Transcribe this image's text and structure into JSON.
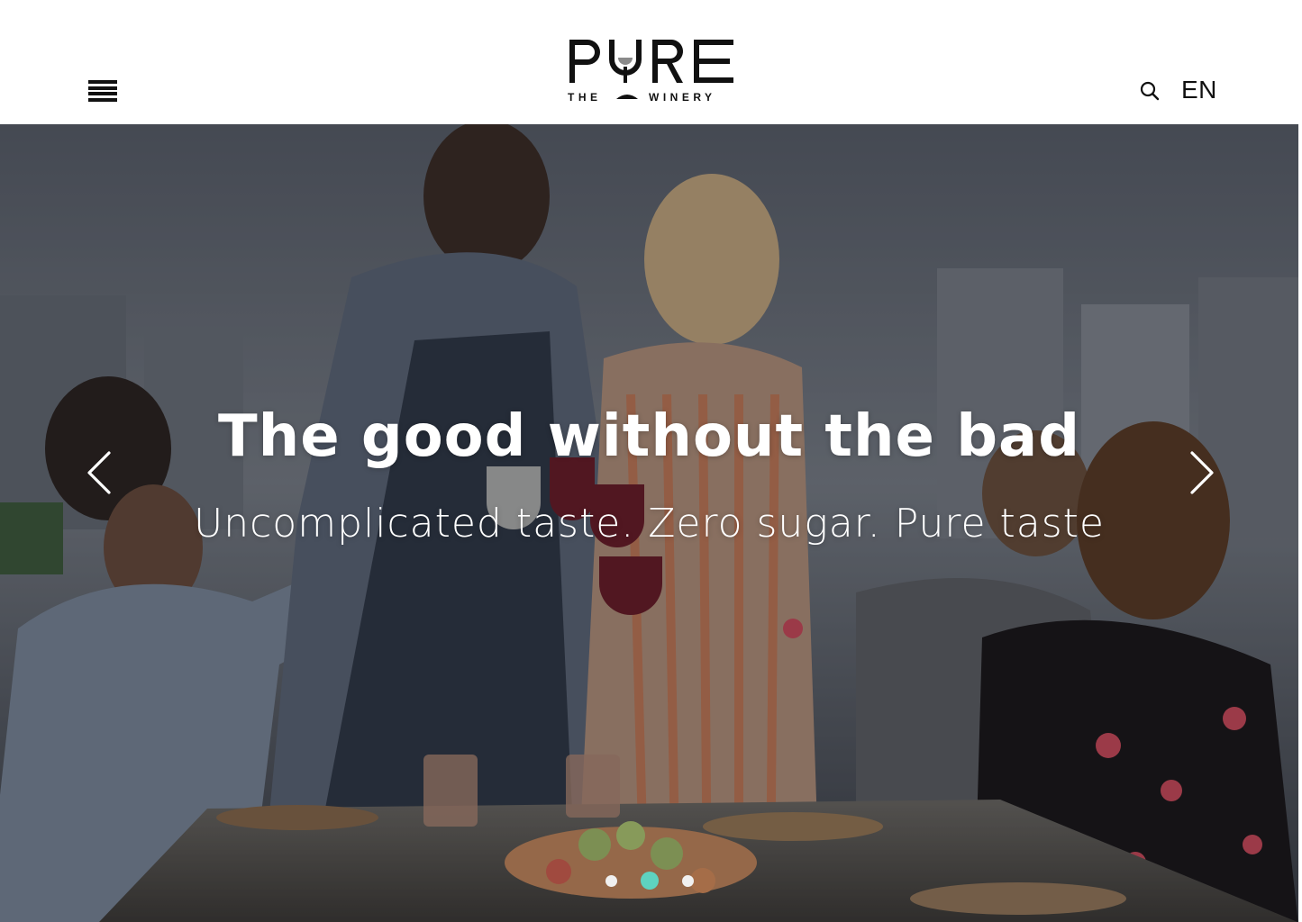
{
  "header": {
    "menu_icon": "hamburger-icon",
    "logo_text": "PURE",
    "logo_subtext": "THE WINERY",
    "search_icon": "search-icon",
    "language": "EN"
  },
  "hero": {
    "title": "The good without the bad",
    "subtitle": "Uncomplicated taste. Zero sugar. Pure taste",
    "prev_icon": "chevron-left-icon",
    "next_icon": "chevron-right-icon",
    "slides": [
      {
        "active": false
      },
      {
        "active": true
      },
      {
        "active": false
      }
    ]
  },
  "colors": {
    "accent": "#5ed3c0",
    "text_dark": "#111111",
    "white": "#ffffff"
  }
}
